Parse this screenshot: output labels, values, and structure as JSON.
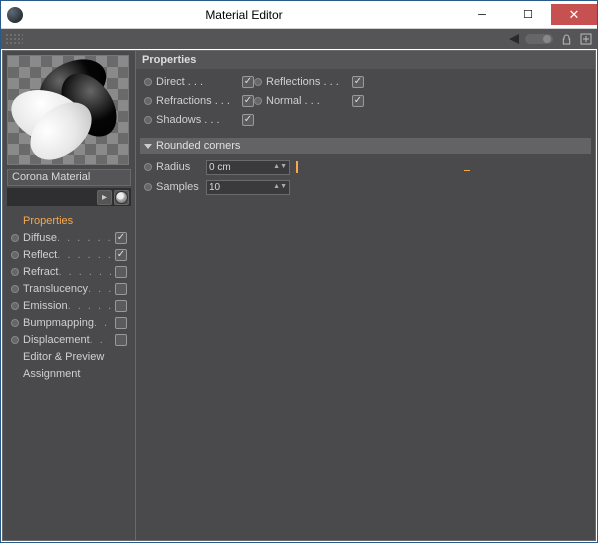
{
  "window": {
    "title": "Material Editor"
  },
  "material_name": "Corona Material",
  "sidebar": {
    "selected_label": "Properties",
    "items": [
      {
        "label": "Properties",
        "checked": null,
        "selected": true,
        "has_bullet": false
      },
      {
        "label": "Diffuse",
        "checked": true,
        "selected": false,
        "has_bullet": true
      },
      {
        "label": "Reflect",
        "checked": true,
        "selected": false,
        "has_bullet": true
      },
      {
        "label": "Refract",
        "checked": false,
        "selected": false,
        "has_bullet": true
      },
      {
        "label": "Translucency",
        "checked": false,
        "selected": false,
        "has_bullet": true
      },
      {
        "label": "Emission",
        "checked": false,
        "selected": false,
        "has_bullet": true
      },
      {
        "label": "Bumpmapping",
        "checked": false,
        "selected": false,
        "has_bullet": true
      },
      {
        "label": "Displacement",
        "checked": false,
        "selected": false,
        "has_bullet": true
      },
      {
        "label": "Editor & Preview",
        "checked": null,
        "selected": false,
        "has_bullet": false
      },
      {
        "label": "Assignment",
        "checked": null,
        "selected": false,
        "has_bullet": false
      }
    ]
  },
  "properties": {
    "header": "Properties",
    "checks": [
      {
        "label": "Direct",
        "checked": true
      },
      {
        "label": "Reflections",
        "checked": true
      },
      {
        "label": "Refractions",
        "checked": true
      },
      {
        "label": "Normal",
        "checked": true
      },
      {
        "label": "Shadows",
        "checked": true
      }
    ],
    "rounded": {
      "header": "Rounded corners",
      "radius_label": "Radius",
      "radius_value": "0 cm",
      "samples_label": "Samples",
      "samples_value": "10"
    }
  }
}
